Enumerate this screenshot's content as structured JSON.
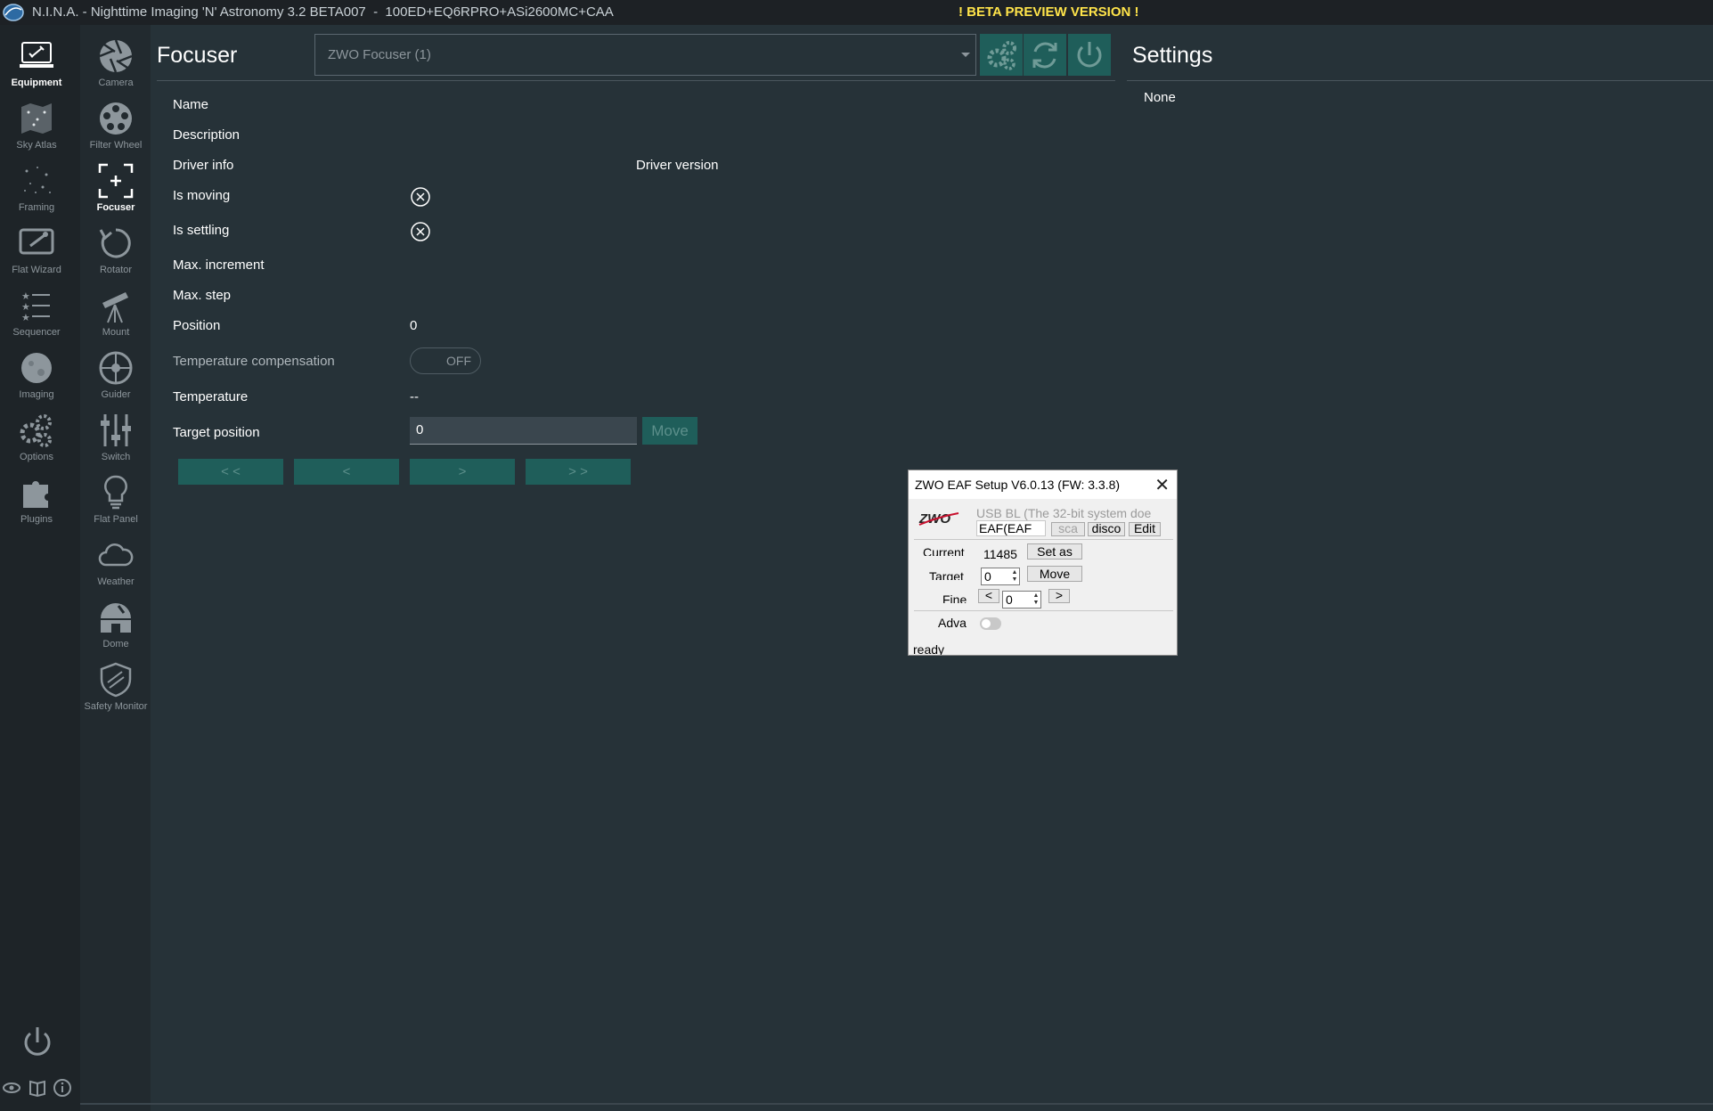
{
  "window": {
    "title": "N.I.N.A. - Nighttime Imaging 'N' Astronomy 3.2 BETA007  -  100ED+EQ6RPRO+ASi2600MC+CAA",
    "beta_notice": "! BETA PREVIEW VERSION !"
  },
  "main_nav": [
    {
      "label": "Equipment",
      "icon": "laptop-icon",
      "active": true
    },
    {
      "label": "Sky Atlas",
      "icon": "star-map-icon"
    },
    {
      "label": "Framing",
      "icon": "stars-icon"
    },
    {
      "label": "Flat Wizard",
      "icon": "flat-wizard-icon"
    },
    {
      "label": "Sequencer",
      "icon": "star-list-icon"
    },
    {
      "label": "Imaging",
      "icon": "moon-icon"
    },
    {
      "label": "Options",
      "icon": "gears-icon"
    },
    {
      "label": "Plugins",
      "icon": "puzzle-icon"
    }
  ],
  "equipment_nav": [
    {
      "label": "Camera",
      "icon": "aperture-icon"
    },
    {
      "label": "Filter Wheel",
      "icon": "filter-wheel-icon"
    },
    {
      "label": "Focuser",
      "icon": "focus-icon",
      "active": true
    },
    {
      "label": "Rotator",
      "icon": "rotate-icon"
    },
    {
      "label": "Mount",
      "icon": "telescope-icon"
    },
    {
      "label": "Guider",
      "icon": "crosshair-icon"
    },
    {
      "label": "Switch",
      "icon": "sliders-icon"
    },
    {
      "label": "Flat Panel",
      "icon": "bulb-icon"
    },
    {
      "label": "Weather",
      "icon": "cloud-icon"
    },
    {
      "label": "Dome",
      "icon": "dome-icon"
    },
    {
      "label": "Safety Monitor",
      "icon": "shield-icon"
    }
  ],
  "focuser": {
    "title": "Focuser",
    "selected_device": "ZWO Focuser (1)",
    "props": {
      "name": "Name",
      "description": "Description",
      "driver_info": "Driver info",
      "driver_version": "Driver version",
      "is_moving": "Is moving",
      "is_settling": "Is settling",
      "max_increment": "Max. increment",
      "max_step": "Max. step",
      "position": "Position",
      "position_value": "0",
      "temp_comp": "Temperature compensation",
      "temp_comp_state": "OFF",
      "temperature": "Temperature",
      "temperature_value": "--",
      "target_position": "Target position",
      "target_value": "0"
    },
    "move_label": "Move",
    "step_buttons": [
      "< <",
      "<",
      ">",
      "> >"
    ]
  },
  "settings": {
    "title": "Settings",
    "value": "None"
  },
  "zwo_dialog": {
    "title": "ZWO EAF Setup V6.0.13 (FW: 3.3.8)",
    "logo_text": "ZWO",
    "usb_text": "USB BL (The 32-bit system doe",
    "device_combo": "EAF(EAF",
    "scan_btn": "sca",
    "disconnect_btn": "disco",
    "edit_btn": "Edit",
    "current_label": "Current",
    "current_value": "11485",
    "set_as_btn": "Set as",
    "target_label": "Target",
    "target_value": "0",
    "move_btn": "Move",
    "fine_label": "Fine",
    "fine_left": "<",
    "fine_value": "0",
    "fine_right": ">",
    "advanced_label": "Adva",
    "status": "ready"
  },
  "colors": {
    "background": "#263238",
    "accent": "#1f5e5a",
    "beta": "#ffe44a"
  }
}
